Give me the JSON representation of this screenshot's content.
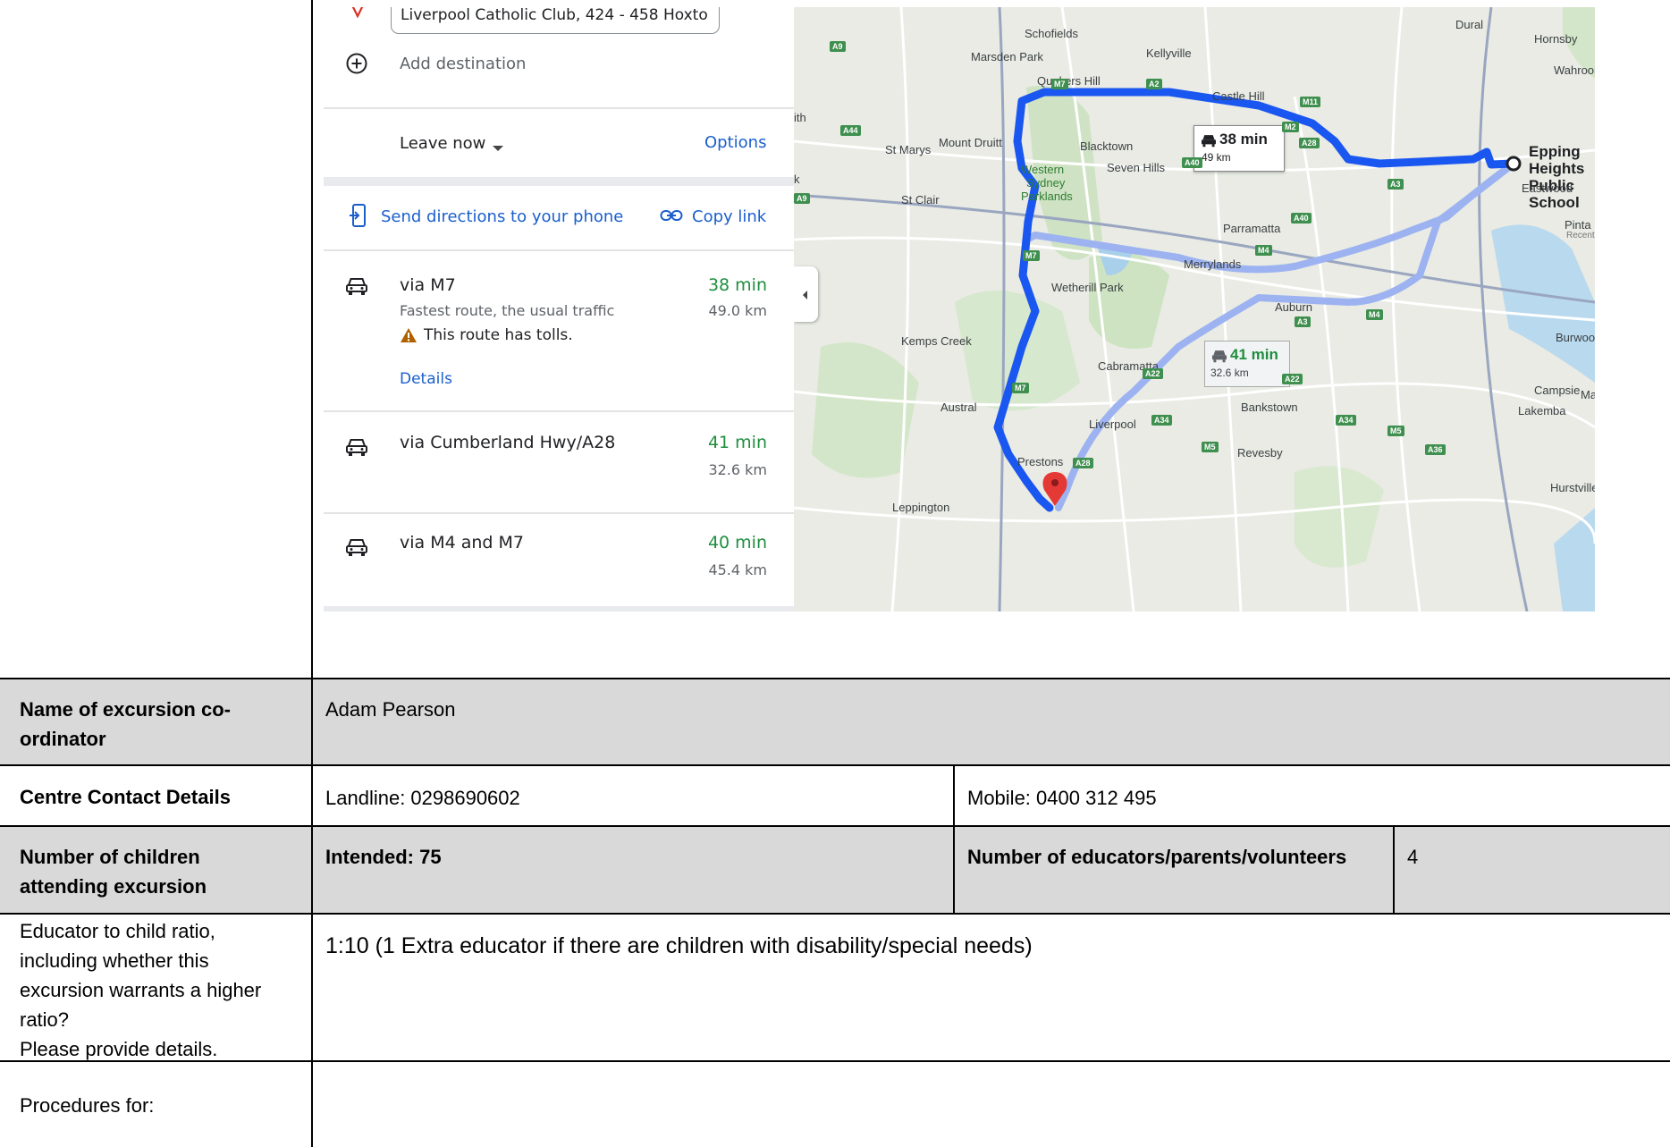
{
  "directions": {
    "destination_value": "Liverpool Catholic Club, 424 - 458 Hoxto",
    "add_destination": "Add destination",
    "leave_now": "Leave now",
    "options": "Options",
    "send_to_phone": "Send directions to your phone",
    "copy_link": "Copy link",
    "routes": [
      {
        "name": "via M7",
        "time": "38 min",
        "distance": "49.0 km",
        "desc": "Fastest route, the usual traffic",
        "warning": "This route has tolls.",
        "details": "Details"
      },
      {
        "name": "via Cumberland Hwy/A28",
        "time": "41 min",
        "distance": "32.6 km"
      },
      {
        "name": "via M4 and M7",
        "time": "40 min",
        "distance": "45.4 km"
      }
    ]
  },
  "map": {
    "places": [
      "Schofields",
      "Dural",
      "Hornsby",
      "Marsden Park",
      "Kellyville",
      "Wahroonga",
      "Quakers Hill",
      "Castle Hill",
      "St Marys",
      "Mount Druitt",
      "Blacktown",
      "Seven Hills",
      "Western",
      "Sydney",
      "Parklands",
      "Eastwood",
      "St Clair",
      "Parramatta",
      "Pinta",
      "Recently",
      "Merrylands",
      "Wetherill Park",
      "Auburn",
      "Burwood",
      "Kemps Creek",
      "Cabramatta",
      "Campsie",
      "Marrick",
      "Austral",
      "Bankstown",
      "Lakemba",
      "Liverpool",
      "Revesby",
      "Prestons",
      "Hurstville",
      "Leppington",
      "ith",
      "k"
    ],
    "destination_label_line1": "Epping Heights",
    "destination_label_line2": "Public School",
    "callout_primary_time": "38 min",
    "callout_primary_distance": "49 km",
    "callout_alt_time": "41 min",
    "callout_alt_distance": "32.6 km",
    "road_shields": [
      "A9",
      "A2",
      "M7",
      "M11",
      "A44",
      "M2",
      "A28",
      "A40",
      "M4",
      "A3",
      "A40",
      "M4",
      "M7",
      "A9",
      "A3",
      "M4",
      "A22",
      "A22",
      "A22",
      "M7",
      "A34",
      "A34",
      "M5",
      "M5",
      "A36",
      "A28"
    ]
  },
  "form": {
    "coordinator_label": "Name of excursion co-ordinator",
    "coordinator_label_l1": "Name of excursion co-",
    "coordinator_label_l2": "ordinator",
    "coordinator_value": "Adam Pearson",
    "contact_label": "Centre Contact Details",
    "landline": "Landline: 0298690602",
    "mobile": "Mobile: 0400 312 495",
    "children_label_l1": "Number of children",
    "children_label_l2": "attending excursion",
    "intended": "Intended: 75",
    "educators_label": "Number of educators/parents/volunteers",
    "educators_value": "4",
    "ratio_label_lines": [
      "Educator to child ratio,",
      "including whether this",
      "excursion warrants a higher",
      "ratio?",
      "Please provide details."
    ],
    "ratio_value": "1:10 (1 Extra educator if there are children with disability/special needs)",
    "procedures_label": "Procedures for:"
  }
}
